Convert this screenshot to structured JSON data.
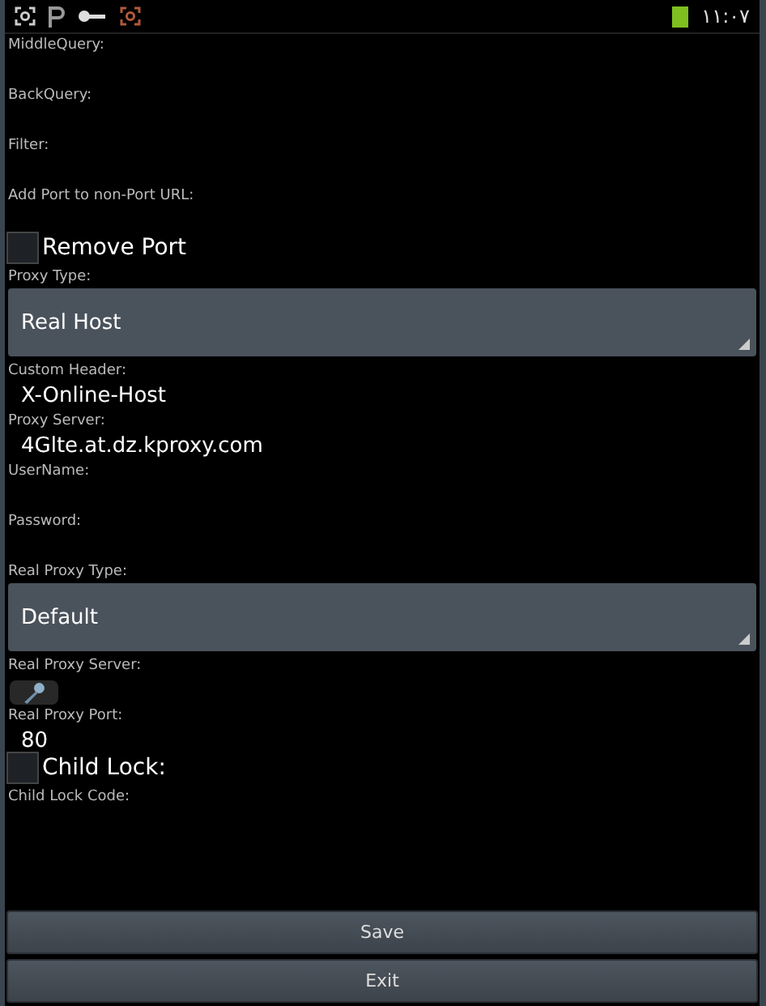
{
  "status_bar": {
    "time": "١١:٠٧"
  },
  "form": [
    {
      "kind": "field",
      "label": "MiddleQuery:"
    },
    {
      "kind": "field",
      "label": "BackQuery:"
    },
    {
      "kind": "field",
      "label": "Filter:"
    },
    {
      "kind": "field",
      "label": "Add Port to non-Port URL:"
    },
    {
      "kind": "checkbox",
      "label": "Remove Port",
      "checked": false
    },
    {
      "kind": "spinner",
      "label": "Proxy Type:",
      "value": "Real Host"
    },
    {
      "kind": "field",
      "label": "Custom Header:",
      "value": "X-Online-Host"
    },
    {
      "kind": "field",
      "label": "Proxy Server:",
      "value": "4Glte.at.dz.kproxy.com"
    },
    {
      "kind": "field",
      "label": "UserName:"
    },
    {
      "kind": "field",
      "label": "Password:"
    },
    {
      "kind": "spinner",
      "label": "Real Proxy Type:",
      "value": "Default"
    },
    {
      "kind": "field",
      "label": "Real Proxy Server:"
    },
    {
      "kind": "field",
      "label": "Real Proxy Port:",
      "value": "80"
    },
    {
      "kind": "checkbox",
      "label": "Child Lock:",
      "checked": false
    },
    {
      "kind": "field",
      "label": "Child Lock Code:"
    }
  ],
  "buttons": [
    "Save",
    "Exit"
  ]
}
